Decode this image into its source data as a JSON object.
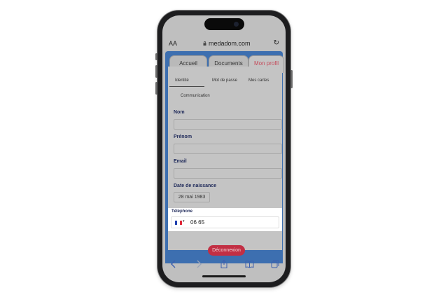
{
  "browser": {
    "aa_label": "AA",
    "url": "medadom.com",
    "reload_icon": "reload-icon",
    "toolbar_icons": [
      "back-icon",
      "forward-icon",
      "share-icon",
      "bookmarks-icon",
      "tabs-icon"
    ]
  },
  "tabs": [
    {
      "label": "Accueil",
      "active": false
    },
    {
      "label": "Documents",
      "active": false
    },
    {
      "label": "Mon profil",
      "active": true
    }
  ],
  "subtabs": [
    "Identité",
    "Mot de passe",
    "Mes cartes",
    "Communication"
  ],
  "form": {
    "nom_label": "Nom",
    "prenom_label": "Prénom",
    "email_label": "Email",
    "dob_label": "Date de naissance",
    "dob_value": "28 mai 1983",
    "phone_label": "Téléphone",
    "phone_value": "06 65",
    "phone_country_caret": "▾"
  },
  "logout_label": "Déconnexion",
  "colors": {
    "accent": "#c22f44",
    "active_tab_text": "#c44a5a",
    "label_navy": "#1f2a5a",
    "page_blue": "#3d6fb0"
  }
}
